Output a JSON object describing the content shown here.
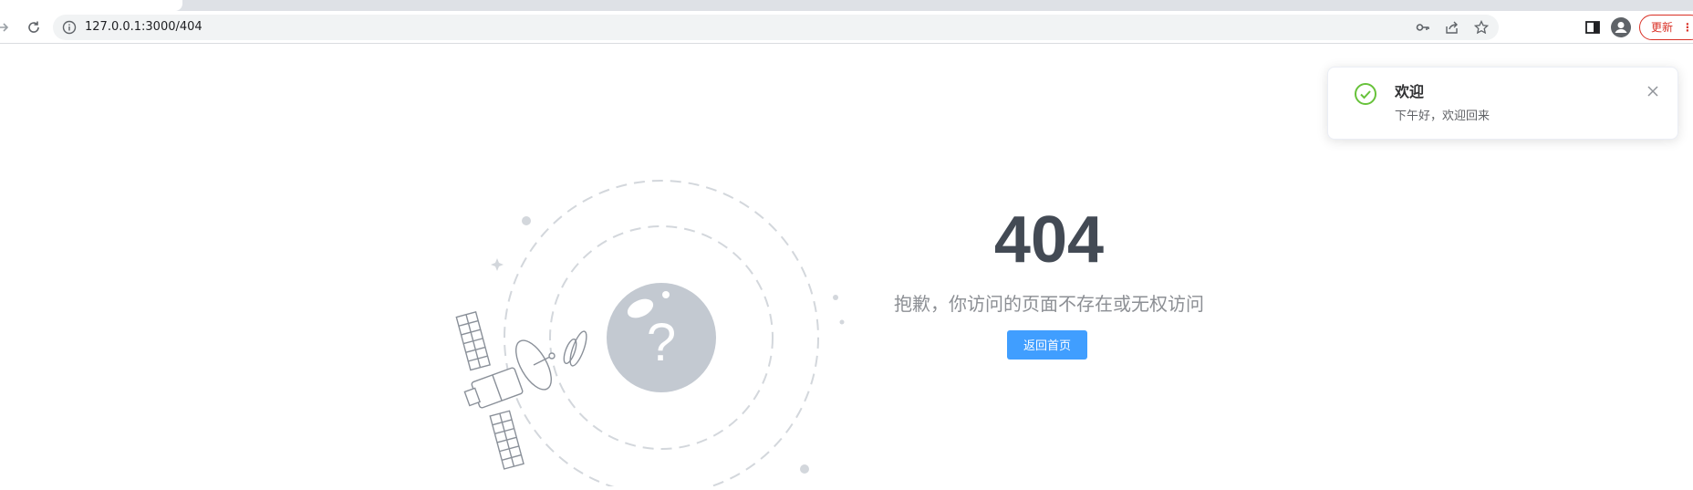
{
  "browser": {
    "url": "127.0.0.1:3000/404",
    "update_label": "更新"
  },
  "notification": {
    "title": "欢迎",
    "message": "下午好，欢迎回来"
  },
  "error_page": {
    "code": "404",
    "message": "抱歉，你访问的页面不存在或无权访问",
    "home_button": "返回首页"
  },
  "colors": {
    "primary": "#409eff",
    "success": "#67c23a",
    "illustration_gray": "#c0c6ce"
  }
}
